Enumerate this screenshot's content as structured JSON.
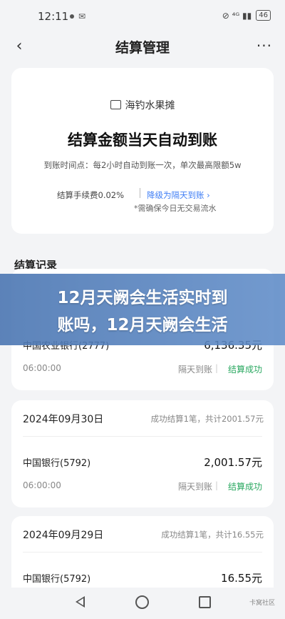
{
  "status": {
    "time": "12:11",
    "msg": "✉",
    "network": "⊘ ⁴ᴳ ▮▮",
    "battery": "46"
  },
  "nav": {
    "title": "结算管理",
    "back": "‹",
    "more": "···"
  },
  "summary_card": {
    "merchant": "海钓水果摊",
    "headline": "结算金额当天自动到账",
    "schedule": "到账时间点：每2小时自动到账一次，单次最高限额5w",
    "fee": "结算手续费0.02%",
    "upgrade": "降级为隔天到账 ›",
    "note": "*需确保今日无交易流水"
  },
  "records": {
    "title": "结算记录",
    "groups": [
      {
        "bank": "中国农业银行(2777)",
        "amount": "6,136.35元",
        "time": "06:00:00",
        "mode": "隔天到账",
        "status": "结算成功"
      },
      {
        "date": "2024年09月30日",
        "summary": "成功结算1笔，共计2001.57元",
        "bank": "中国银行(5792)",
        "amount": "2,001.57元",
        "time": "06:00:00",
        "mode": "隔天到账",
        "status": "结算成功"
      },
      {
        "date": "2024年09月29日",
        "summary": "成功结算1笔，共计16.55元",
        "bank": "中国银行(5792)",
        "amount": "16.55元"
      }
    ]
  },
  "banner": {
    "line1": "12月天阙会生活实时到",
    "line2": "账吗，12月天阙会生活"
  },
  "watermark": "卡窝社区"
}
